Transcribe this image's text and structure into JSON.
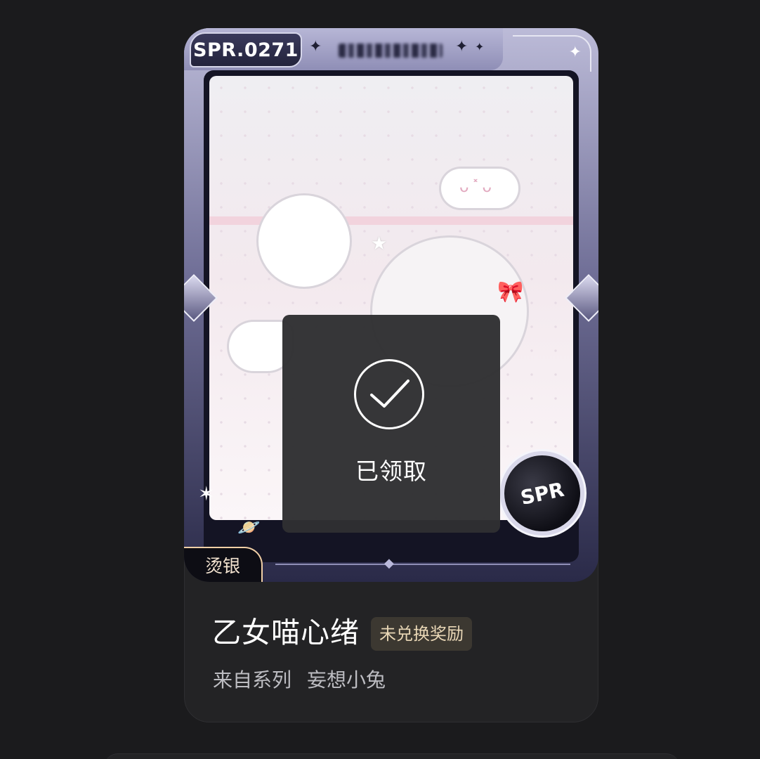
{
  "card": {
    "serial": "SPR.0271",
    "owner_name_blurred": "",
    "finish_tag": "烫银",
    "seal_text": "SPR",
    "claimed_overlay": {
      "status_label": "已领取",
      "icon": "check-circle-icon"
    }
  },
  "info": {
    "title": "乙女喵心绪",
    "reward_status": "未兑换奖励",
    "series_prefix": "来自系列",
    "series_name": "妄想小兔"
  },
  "colors": {
    "background": "#1b1b1d",
    "panel": "#232325",
    "badge_bg": "#3c3831",
    "badge_text": "#e9d7b6",
    "subtext": "#bdbdc2"
  }
}
